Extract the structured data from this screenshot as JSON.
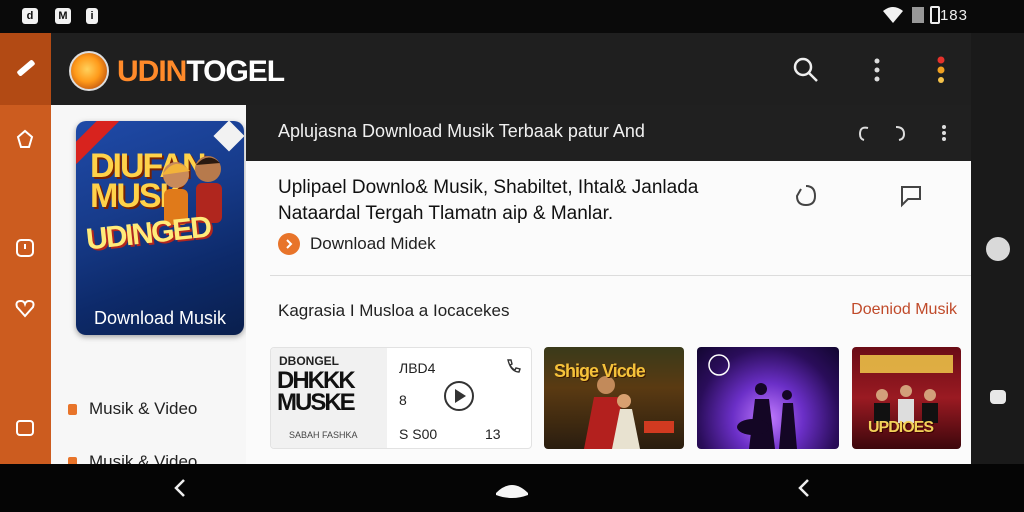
{
  "statusbar": {
    "left_icons": [
      "d",
      "M",
      "i"
    ],
    "time": "183"
  },
  "app": {
    "logo_prefix": "UDIN",
    "logo_suffix": "TOGEL"
  },
  "subheader": {
    "title": "Aplujasna Download Musik Terbaak patur And"
  },
  "cover": {
    "art_line1": "DIUFAN\nMUSK",
    "art_line2": "UDINGED",
    "label": "Download Musik"
  },
  "categories": [
    {
      "label": "Musik & Video"
    },
    {
      "label": "Musik & Video"
    }
  ],
  "content": {
    "headline": "Uplipael Downlo& Musik, Shabiltet, Ihtal& Janlada Nataardal Tergah Tlamatn aip & Manlar.",
    "cta_label": "Download Midek",
    "section_title": "Kagrasia I Musloa a Iocacekes",
    "section_link": "Doeniod Musik"
  },
  "cards": {
    "card1": {
      "art_top": "DBONGEL",
      "art_main": "DHKKK\nMUSKE",
      "art_bottom": "SABAH FASHKA",
      "text_top": "ЛBD4",
      "text_mid": "8",
      "text_bot": "S S00",
      "text_right": "13"
    },
    "card2": {
      "title": "Shige Vicde"
    },
    "card3": {
      "title": ""
    },
    "card4": {
      "title": "UPDIOES"
    }
  },
  "colors": {
    "accent": "#e8742a",
    "rail": "#cc5c1f",
    "topbar": "#1f1f1f"
  }
}
